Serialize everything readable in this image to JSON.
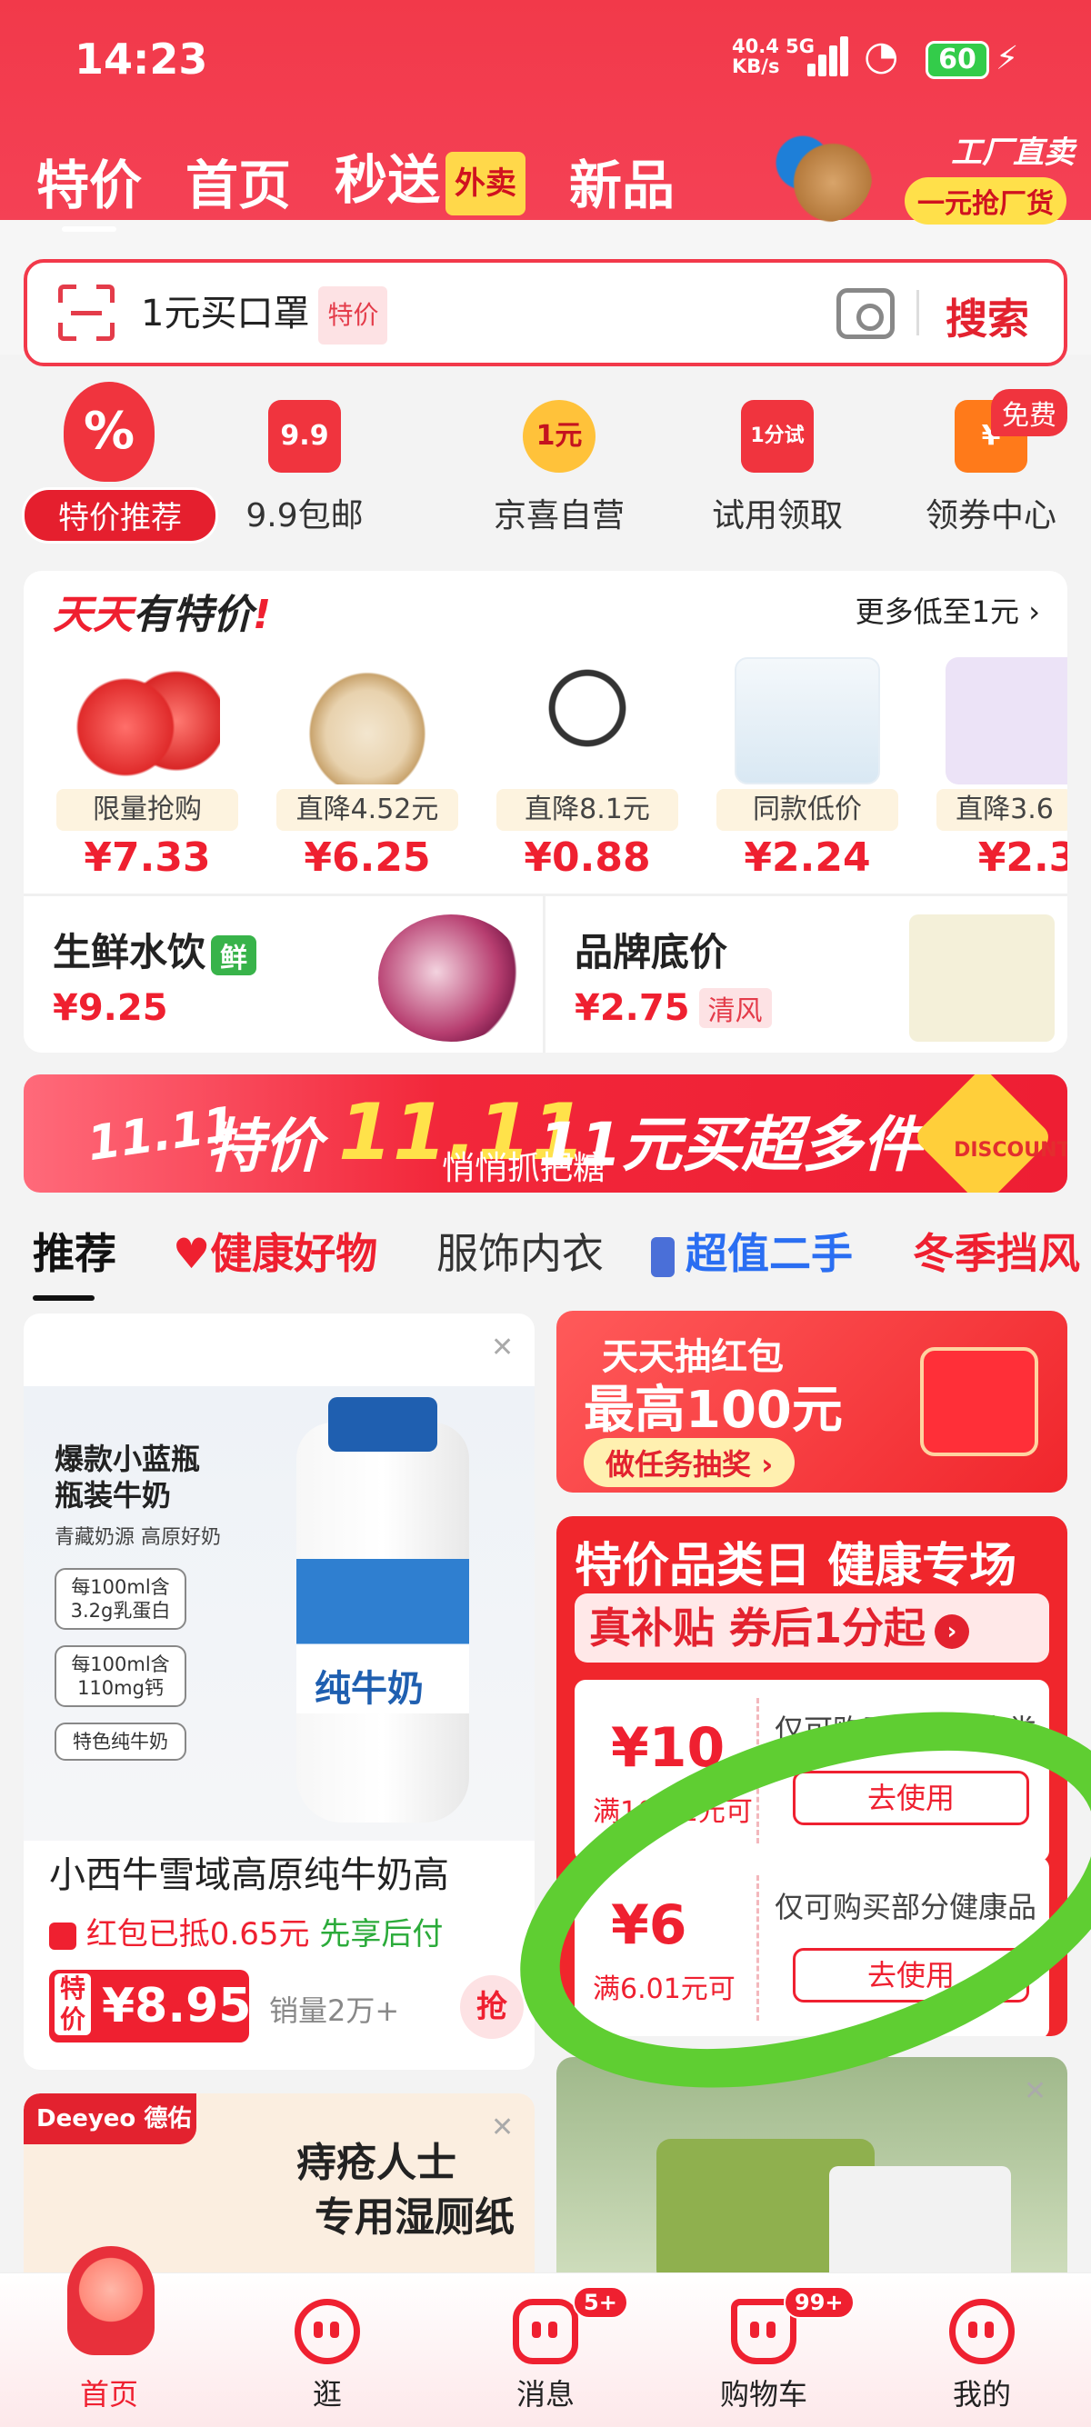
{
  "status": {
    "time": "14:23",
    "net_speed": "40.4",
    "net_unit": "KB/s",
    "net_type": "5G",
    "battery": "60"
  },
  "top_tabs": [
    {
      "label": "特价"
    },
    {
      "label": "首页"
    },
    {
      "label": "秒送",
      "badge": "外卖"
    },
    {
      "label": "新品"
    }
  ],
  "factory": {
    "title": "工厂直卖",
    "button": "一元抢厂货"
  },
  "search": {
    "placeholder": "1元买口罩",
    "tag": "特价",
    "button": "搜索"
  },
  "categories": [
    {
      "label": "特价推荐",
      "icon": "%"
    },
    {
      "label": "9.9包邮",
      "icon": "9.9"
    },
    {
      "label": "京喜自营",
      "icon": "1元"
    },
    {
      "label": "试用领取",
      "icon": "1分试"
    },
    {
      "label": "领券中心",
      "icon": "¥",
      "badge": "免费"
    }
  ],
  "daily": {
    "title_red": "天天",
    "title_black": "有特价",
    "more": "更多低至1元 ›",
    "items": [
      {
        "tag": "限量抢购",
        "price": "¥7.33",
        "image": "apples"
      },
      {
        "tag": "直降4.52元",
        "price": "¥6.25",
        "image": "eggs"
      },
      {
        "tag": "直降8.1元",
        "price": "¥0.88",
        "image": "cable"
      },
      {
        "tag": "同款低价",
        "price": "¥2.24",
        "image": "medical-mask"
      },
      {
        "tag": "直降3.6",
        "price": "¥2.3",
        "image": "tissue"
      }
    ],
    "fresh": {
      "title": "生鲜水饮",
      "tag": "鲜",
      "price": "¥9.25"
    },
    "brand": {
      "title": "品牌底价",
      "price": "¥2.75",
      "tag": "清风"
    }
  },
  "banner": {
    "part1": "特价",
    "part2": "11.11",
    "part3": "11元买超多件",
    "subtitle": "悄悄抓把糖",
    "tag": "11.11",
    "discount": "DISCOUNT"
  },
  "feed_tabs": [
    {
      "label": "推荐"
    },
    {
      "label": "健康好物"
    },
    {
      "label": "服饰内衣"
    },
    {
      "label": "超值二手"
    },
    {
      "label": "冬季挡风"
    }
  ],
  "milk": {
    "headline1": "爆款小蓝瓶",
    "headline2": "瓶装牛奶",
    "sub": "青藏奶源 高原好奶",
    "chips": [
      "每100ml含3.2g乳蛋白",
      "每100ml含110mg钙",
      "特色纯牛奶"
    ],
    "label": "纯牛奶",
    "title": "小西牛雪域高原纯牛奶高",
    "promo": "红包已抵0.65元",
    "promo2": "先享后付",
    "price_tag": "特价",
    "price": "¥8.95",
    "sales": "销量2万+",
    "grab": "抢"
  },
  "redpack": {
    "line1": "天天抽红包",
    "line2": "最高100元",
    "button": "做任务抽奖 ›"
  },
  "health": {
    "title": "特价品类日 健康专场",
    "subtitle": "真补贴 券后1分起",
    "coupons": [
      {
        "amount": "¥10",
        "condition": "满10.01元可",
        "desc": "仅可购买部分健康类",
        "button": "去使用"
      },
      {
        "amount": "¥6",
        "condition": "满6.01元可",
        "desc": "仅可购买部分健康品",
        "button": "去使用"
      }
    ]
  },
  "deeyeo": {
    "brand": "Deeyeo 德佑",
    "line1": "痔疮人士",
    "line2": "专用湿厕纸"
  },
  "bottom_nav": [
    {
      "label": "首页"
    },
    {
      "label": "逛"
    },
    {
      "label": "消息",
      "badge": "5+"
    },
    {
      "label": "购物车",
      "badge": "99+"
    },
    {
      "label": "我的"
    }
  ],
  "colors": {
    "brand_red": "#f2394a",
    "annotation_green": "#5fce32"
  }
}
